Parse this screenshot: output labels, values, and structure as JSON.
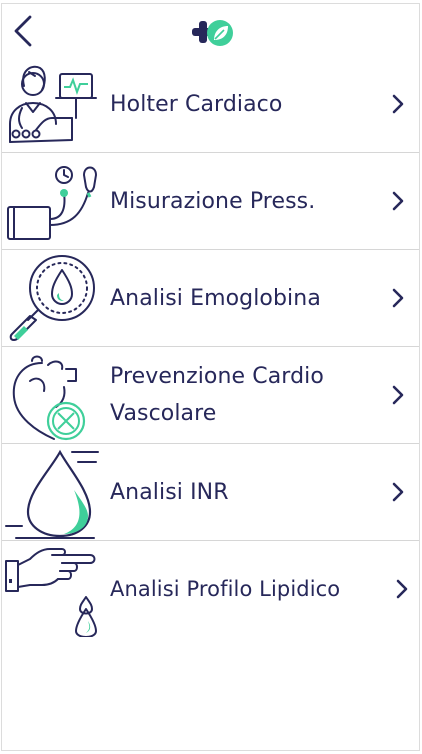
{
  "header": {
    "back_icon": "chevron-left-icon",
    "logo_icon": "pharmacy-cross-leaf-logo"
  },
  "colors": {
    "navy": "#27285a",
    "accent": "#3fcf9a",
    "divider": "#d6d6d6"
  },
  "services": [
    {
      "label": "Holter Cardiaco",
      "icon": "holter-doctor-icon"
    },
    {
      "label": "Misurazione Press.",
      "icon": "blood-pressure-cuff-icon"
    },
    {
      "label": "Analisi Emoglobina",
      "icon": "magnifier-blood-drop-icon"
    },
    {
      "label": "Prevenzione Cardio\nVascolare",
      "icon": "heart-bandaid-icon"
    },
    {
      "label": "Analisi INR",
      "icon": "water-drop-icon"
    },
    {
      "label": "Analisi Profilo Lipidico",
      "icon": "finger-prick-drop-icon"
    }
  ]
}
